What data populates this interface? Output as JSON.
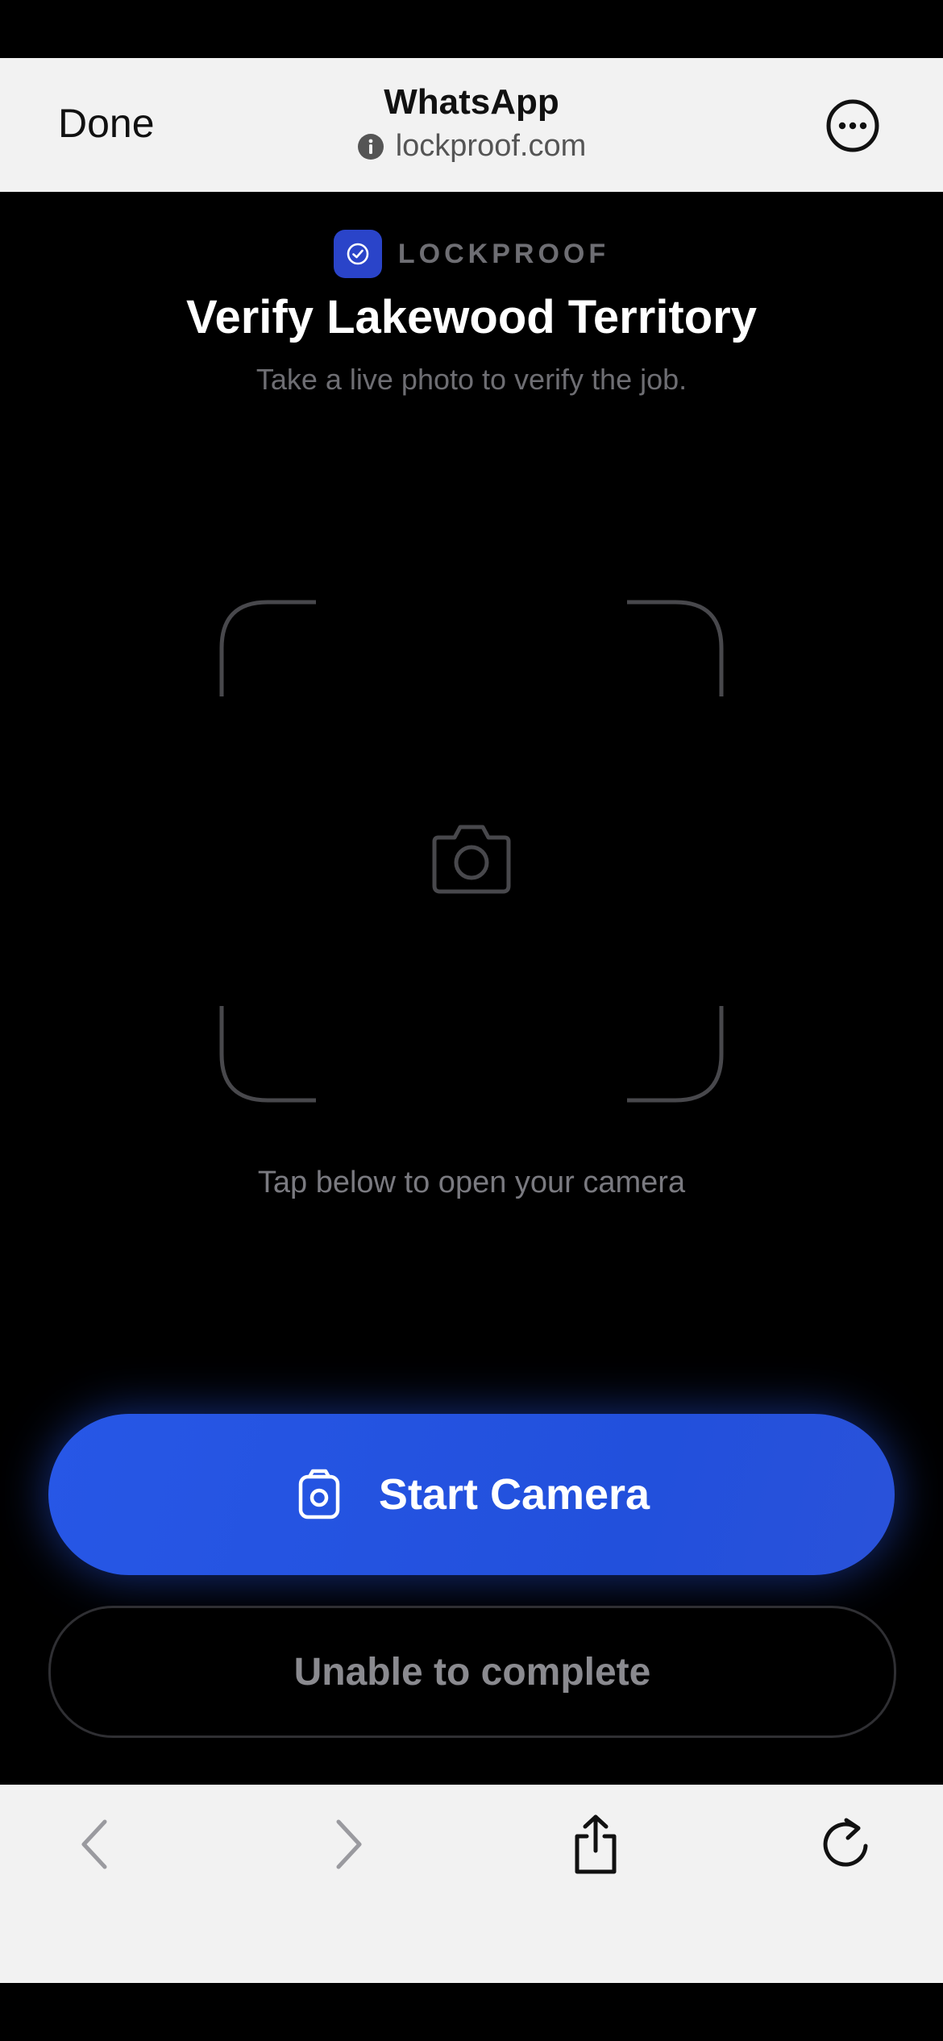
{
  "browser": {
    "done_label": "Done",
    "title": "WhatsApp",
    "url": "lockproof.com"
  },
  "brand": {
    "name": "LOCKPROOF",
    "color": "#2a44c9"
  },
  "page": {
    "title": "Verify Lakewood Territory",
    "subtitle": "Take a live photo to verify the job.",
    "hint": "Tap below to open your camera"
  },
  "actions": {
    "start_camera": "Start Camera",
    "unable": "Unable to complete"
  },
  "colors": {
    "accent": "#2757e6",
    "background": "#000000",
    "muted_text": "#6e6e73"
  },
  "icons": {
    "header": [
      "info-icon",
      "more-icon"
    ],
    "toolbar": [
      "back-icon",
      "forward-icon",
      "share-icon",
      "reload-icon"
    ],
    "content": [
      "checkmark-badge-icon",
      "camera-icon"
    ]
  }
}
